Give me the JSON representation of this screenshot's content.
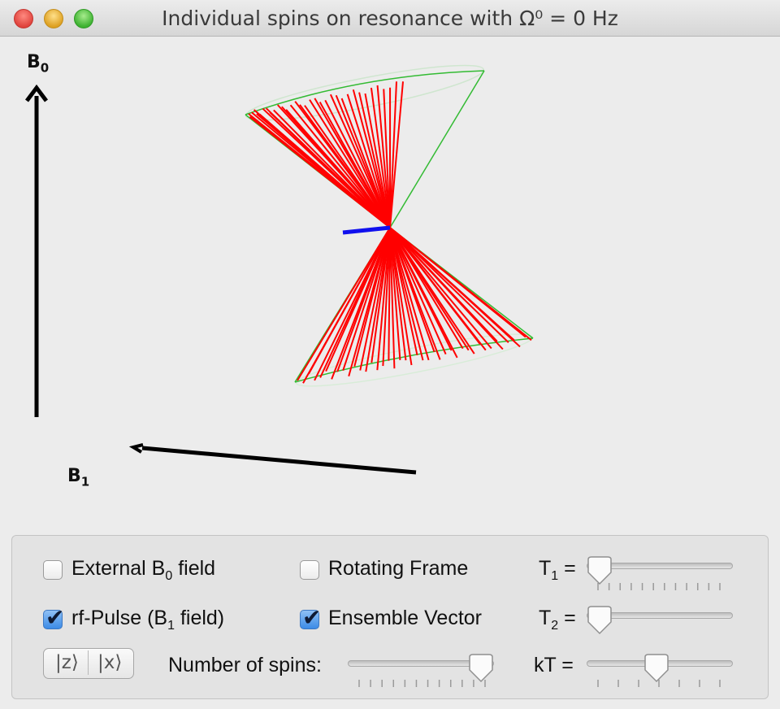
{
  "window": {
    "title": "Individual spins on resonance with Ω⁰ = 0 Hz"
  },
  "scene": {
    "b0_label": "B",
    "b0_sub": "0",
    "b1_label": "B",
    "b1_sub": "1",
    "colors": {
      "spins": "#ff0000",
      "cone": "#33bb33",
      "ensemble": "#0000ee",
      "field": "#000000"
    }
  },
  "controls": {
    "external_b0": {
      "label": "External B",
      "sub": "0",
      "label_after": " field",
      "checked": false
    },
    "rotating_frame": {
      "label": "Rotating Frame",
      "checked": false
    },
    "rf_pulse": {
      "label": "rf-Pulse (B",
      "sub": "1",
      "label_after": " field)",
      "checked": true
    },
    "ensemble_vector": {
      "label": "Ensemble Vector",
      "checked": true
    },
    "t1": {
      "label": "T",
      "sub": "1",
      "label_after": " =",
      "level": 0.0
    },
    "t2": {
      "label": "T",
      "sub": "2",
      "label_after": " =",
      "level": 0.0
    },
    "kt": {
      "label": "kT =",
      "level": 0.47
    },
    "num_spins": {
      "label": "Number of spins:",
      "level": 1.0
    },
    "state_button": {
      "left": "|z⟩",
      "right": "|x⟩"
    }
  }
}
